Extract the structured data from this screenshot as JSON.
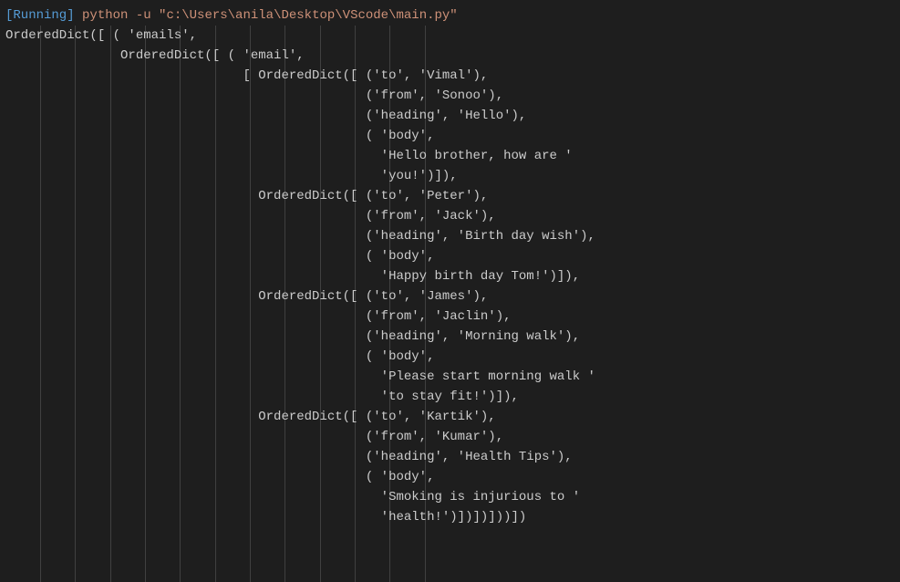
{
  "terminal": {
    "status_tag": "[Running]",
    "command": "python -u \"c:\\Users\\anila\\Desktop\\VScode\\main.py\"",
    "output_lines": [
      "OrderedDict([ ( 'emails',",
      "               OrderedDict([ ( 'email',",
      "                               [ OrderedDict([ ('to', 'Vimal'),",
      "                                               ('from', 'Sonoo'),",
      "                                               ('heading', 'Hello'),",
      "                                               ( 'body',",
      "                                                 'Hello brother, how are '",
      "                                                 'you!')]),",
      "                                 OrderedDict([ ('to', 'Peter'),",
      "                                               ('from', 'Jack'),",
      "                                               ('heading', 'Birth day wish'),",
      "                                               ( 'body',",
      "                                                 'Happy birth day Tom!')]),",
      "                                 OrderedDict([ ('to', 'James'),",
      "                                               ('from', 'Jaclin'),",
      "                                               ('heading', 'Morning walk'),",
      "                                               ( 'body',",
      "                                                 'Please start morning walk '",
      "                                                 'to stay fit!')]),",
      "                                 OrderedDict([ ('to', 'Kartik'),",
      "                                               ('from', 'Kumar'),",
      "                                               ('heading', 'Health Tips'),",
      "                                               ( 'body',",
      "                                                 'Smoking is injurious to '",
      "                                                 'health!')])])]))])"
    ]
  },
  "guide_positions": [
    38,
    76,
    115,
    153,
    191,
    230,
    268,
    306,
    345,
    383,
    421,
    460
  ]
}
